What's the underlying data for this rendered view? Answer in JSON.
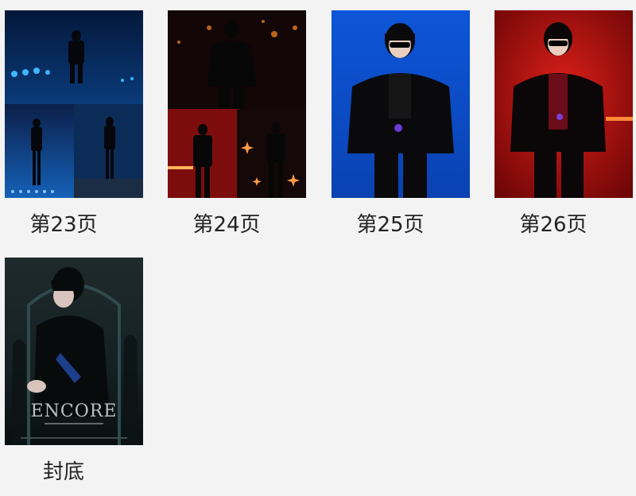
{
  "gallery": {
    "items": [
      {
        "caption": "第23页",
        "thumbnail": "concert-collage-blue-stage"
      },
      {
        "caption": "第24页",
        "thumbnail": "concert-collage-dark-red"
      },
      {
        "caption": "第25页",
        "thumbnail": "performer-blue-background"
      },
      {
        "caption": "第26页",
        "thumbnail": "performer-red-background"
      },
      {
        "caption": "封底",
        "thumbnail": "back-cover-poster"
      }
    ],
    "back_cover": {
      "poster_title": "ENCORE"
    },
    "colors": {
      "background": "#f3f3f3",
      "caption_text": "#222222",
      "blue_accent": "#0b5fd6",
      "red_accent": "#c41414"
    }
  }
}
